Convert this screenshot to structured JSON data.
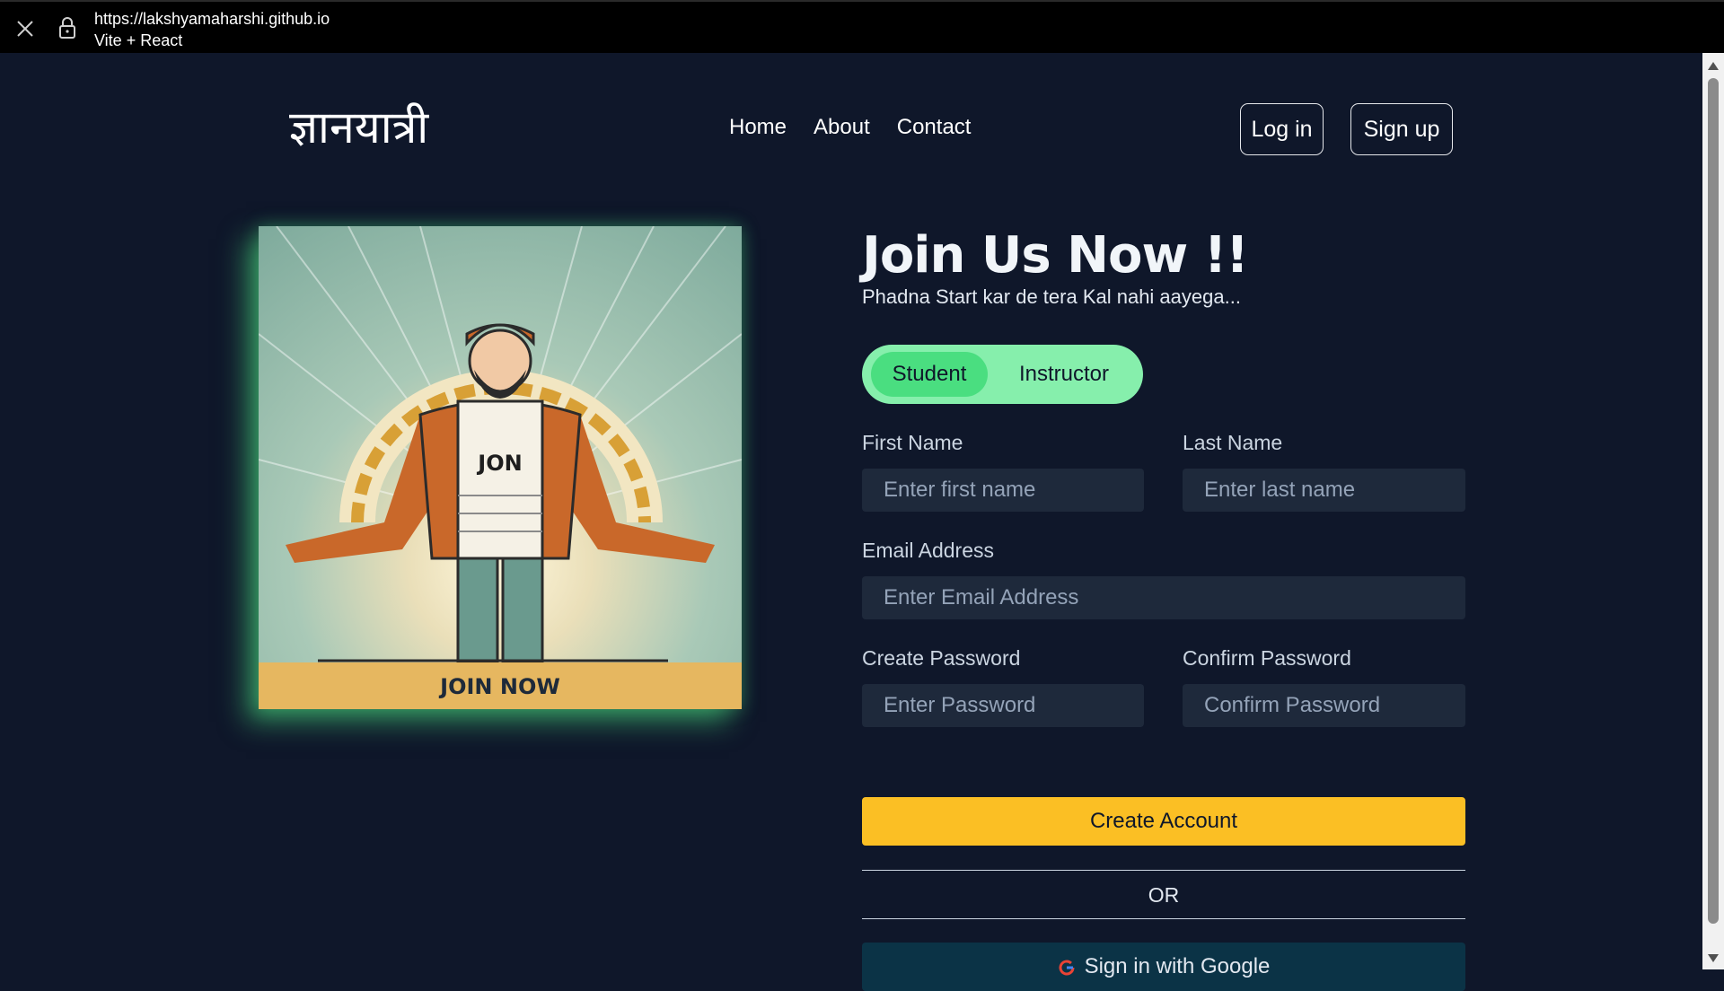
{
  "browser": {
    "url": "https://lakshyamaharshi.github.io",
    "tab_title": "Vite + React"
  },
  "header": {
    "logo": "ज्ञानयात्री",
    "nav": [
      "Home",
      "About",
      "Contact"
    ],
    "login_label": "Log in",
    "signup_label": "Sign up"
  },
  "illustration": {
    "shirt_text": "JON",
    "banner_text": "JOIN NOW"
  },
  "form": {
    "heading": "Join Us Now !!",
    "subheading": "Phadna Start kar de tera Kal nahi aayega...",
    "roles": [
      "Student",
      "Instructor"
    ],
    "selected_role": "Student",
    "first_name": {
      "label": "First Name",
      "placeholder": "Enter first name",
      "value": ""
    },
    "last_name": {
      "label": "Last Name",
      "placeholder": "Enter last name",
      "value": ""
    },
    "email": {
      "label": "Email Address",
      "placeholder": "Enter Email Address",
      "value": ""
    },
    "password": {
      "label": "Create Password",
      "placeholder": "Enter Password",
      "value": ""
    },
    "confirm_password": {
      "label": "Confirm Password",
      "placeholder": "Confirm Password",
      "value": ""
    },
    "submit_label": "Create Account",
    "divider_label": "OR",
    "google_label": "Sign in with Google"
  },
  "colors": {
    "background": "#0f172a",
    "toggle_bg": "#86efac",
    "toggle_active": "#4ade80",
    "submit": "#fbbf24",
    "input_bg": "#1e293b",
    "google_bg": "#0b3346"
  },
  "icons": [
    "close-icon",
    "lock-icon",
    "google-icon",
    "scroll-up-icon",
    "scroll-down-icon"
  ]
}
